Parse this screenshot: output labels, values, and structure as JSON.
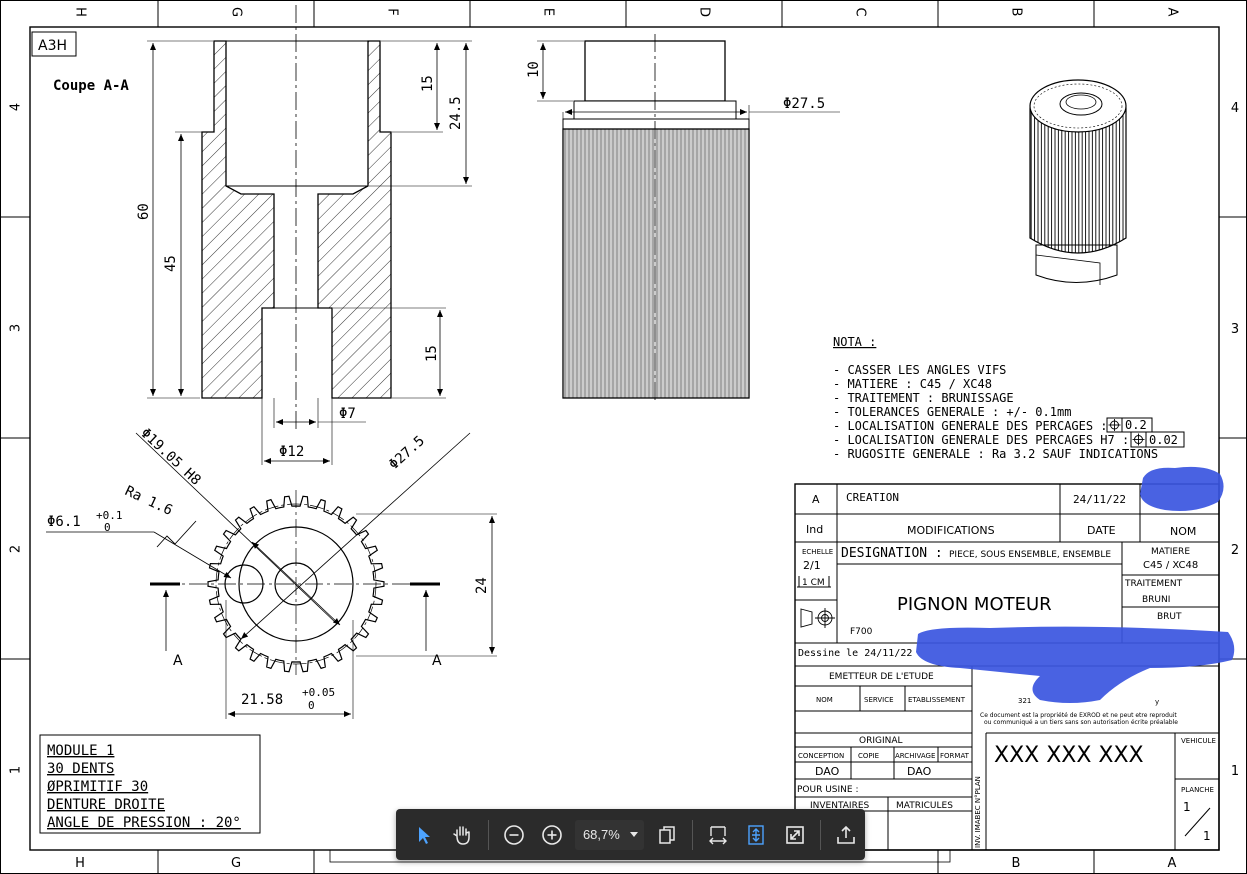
{
  "frame": {
    "cols_top": [
      "H",
      "G",
      "F",
      "E",
      "D",
      "C",
      "B",
      "A"
    ],
    "cols_bottom": [
      "H",
      "G",
      "",
      "",
      "",
      "",
      "B",
      "A"
    ],
    "rows_left": [
      "4",
      "3",
      "2",
      "1"
    ],
    "rows_right": [
      "4",
      "3",
      "2",
      "1"
    ]
  },
  "sheet_format": "A3H",
  "section_title": "Coupe A-A",
  "dimensions": {
    "d60": "60",
    "d45": "45",
    "d15_top": "15",
    "d24_5": "24.5",
    "d15_bottom": "15",
    "phi7": "Φ7",
    "phi12": "Φ12",
    "d10": "10",
    "phi27_5_side": "Φ27.5",
    "phi19_05": "Φ19.05 H8",
    "phi27_5_gear": "Φ27.5",
    "ra": "Ra 1.6",
    "phi6_1": "Φ6.1",
    "phi6_1_upper": "+0.1",
    "phi6_1_lower": "0",
    "d24": "24",
    "d21_58": "21.58",
    "d21_58_upper": "+0.05",
    "d21_58_lower": "0",
    "section_mark_left": "A",
    "section_mark_right": "A"
  },
  "gear_specs": [
    "MODULE 1",
    "30 DENTS",
    "ØPRIMITIF 30",
    "DENTURE DROITE",
    "ANGLE DE PRESSION : 20°"
  ],
  "nota": {
    "title": "NOTA :",
    "items": [
      "- CASSER LES ANGLES VIFS",
      "- MATIERE : C45  / XC48",
      "- TRAITEMENT : BRUNISSAGE",
      "- TOLERANCES GENERALE : +/- 0.1mm",
      "- LOCALISATION GENERALE DES PERCAGES :",
      "- LOCALISATION GENERALE DES PERCAGES H7 :",
      "- RUGOSITE GENERALE : Ra 3.2 SAUF INDICATIONS"
    ],
    "tol1": "0.2",
    "tol2": "0.02"
  },
  "title_block": {
    "rev_index": "A",
    "rev_label": "CREATION",
    "rev_date": "24/11/22",
    "hdr_ind": "Ind",
    "hdr_modifications": "MODIFICATIONS",
    "hdr_date": "DATE",
    "hdr_nom": "NOM",
    "echelle_label": "ECHELLE",
    "echelle_value": "2/1",
    "echelle_bar": "1 CM",
    "designation_label": "DESIGNATION :",
    "designation_hint": "PIECE, SOUS ENSEMBLE, ENSEMBLE",
    "part_name": "PIGNON MOTEUR",
    "part_code": "F700",
    "matiere_label": "MATIERE",
    "matiere_value": "C45 / XC48",
    "traitement_label": "TRAITEMENT",
    "traitement_value": "BRUNI",
    "brut_label": "BRUT",
    "dessine": "Dessine le 24/11/22",
    "emetteur": "EMETTEUR DE L'ETUDE",
    "col_nom": "NOM",
    "col_service": "SERVICE",
    "col_etablissement": "ETABLISSEMENT",
    "address_fragment": "321",
    "address_tail": "y",
    "notice_line1": "Ce document est la propriété de EXROD et ne peut etre reproduit",
    "notice_line2": "ou communiqué a un tiers sans son autorisation écrite préalable",
    "original": "ORIGINAL",
    "conception": "CONCEPTION",
    "copie": "COPIE",
    "archivage": "ARCHIVAGE",
    "format_label": "FORMAT",
    "dao1": "DAO",
    "dao2": "DAO",
    "pour_usine": "POUR USINE :",
    "inventaires": "INVENTAIRES",
    "matricules": "MATRICULES",
    "vertical_label": "INV. IMABEC N°PLAN",
    "plan_number": "XXX XXX XXX",
    "vehicule": "VEHICULE",
    "planche_label": "PLANCHE",
    "planche_num": "1",
    "planche_total": "1"
  },
  "toolbar": {
    "select_tool": "pointer-arrow-icon",
    "pan_tool": "hand-icon",
    "zoom_out": "zoom-out-icon",
    "zoom_in": "zoom-in-icon",
    "zoom_value": "68,7%",
    "page_mode": "pages-icon",
    "fit_width": "fit-width-icon",
    "fit_page": "fit-page-icon",
    "fullscreen": "fullscreen-icon",
    "export": "export-icon",
    "accent": "#4da3ff"
  }
}
